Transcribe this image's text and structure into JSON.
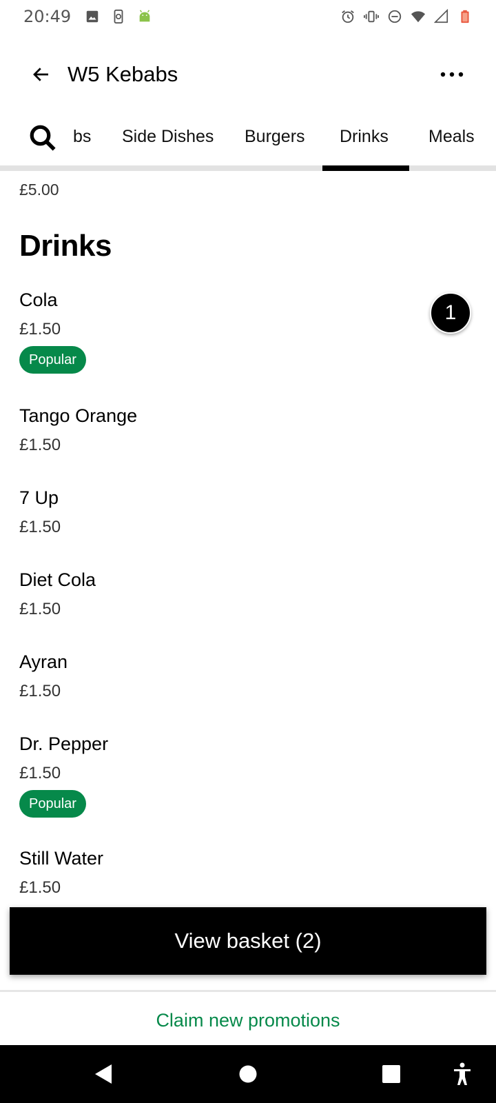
{
  "status_bar": {
    "time": "20:49",
    "left_icons": [
      "image-icon",
      "phone-sync-icon",
      "android-icon"
    ],
    "right_icons": [
      "alarm-icon",
      "vibrate-icon",
      "dnd-icon",
      "wifi-icon",
      "signal-icon",
      "battery-icon"
    ]
  },
  "header": {
    "title": "W5 Kebabs",
    "back_icon": "arrow-left-icon",
    "more_icon": "more-horizontal-icon"
  },
  "tabs": {
    "items": [
      "bs",
      "Side Dishes",
      "Burgers",
      "Drinks",
      "Meals"
    ],
    "active": "Drinks"
  },
  "content": {
    "previous_item_price": "£5.00",
    "section_title": "Drinks",
    "items": [
      {
        "name": "Cola",
        "price": "£1.50",
        "badge": "Popular",
        "quantity": "1"
      },
      {
        "name": "Tango Orange",
        "price": "£1.50"
      },
      {
        "name": "7 Up",
        "price": "£1.50"
      },
      {
        "name": "Diet Cola",
        "price": "£1.50"
      },
      {
        "name": "Ayran",
        "price": "£1.50"
      },
      {
        "name": "Dr. Pepper",
        "price": "£1.50",
        "badge": "Popular"
      },
      {
        "name": "Still Water",
        "price": "£1.50"
      }
    ]
  },
  "basket": {
    "label": "View basket (2)"
  },
  "promo": {
    "label": "Claim new promotions"
  },
  "colors": {
    "accent_green": "#06894a",
    "primary": "#000000"
  }
}
